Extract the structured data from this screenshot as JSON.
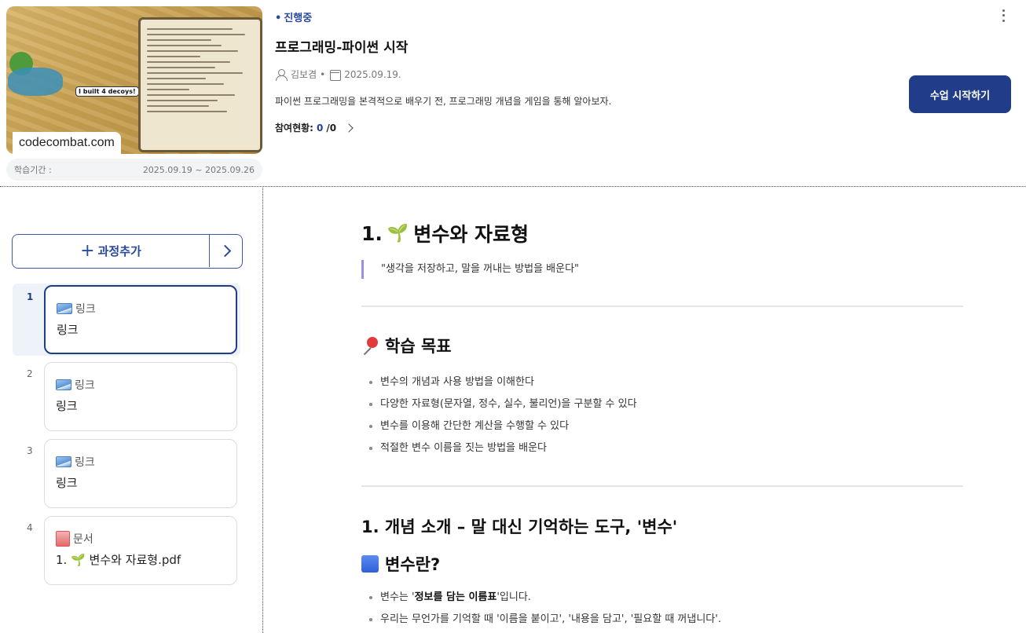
{
  "course": {
    "thumbnail_caption": "codecombat.com",
    "thumbnail_bubble": "I built 4 decoys!",
    "period_label": "학습기간 :",
    "period_value": "2025.09.19 ~ 2025.09.26",
    "status": "진행중",
    "title": "프로그래밍-파이썬 시작",
    "author": "김보겸",
    "meta_separator": "•",
    "date": "2025.09.19.",
    "description": "파이썬 프로그래밍을 본격적으로 배우기 전, 프로그래밍 개념을 게임을 통해 알아보자.",
    "participation_label": "참여현황:",
    "participation_done": "0",
    "participation_total": "/0",
    "start_button": "수업 시작하기"
  },
  "sidebar": {
    "add_button": "과정추가",
    "steps": [
      {
        "index": "1",
        "type": "링크",
        "name": "링크",
        "icon": "image-icon",
        "active": true
      },
      {
        "index": "2",
        "type": "링크",
        "name": "링크",
        "icon": "image-icon",
        "active": false
      },
      {
        "index": "3",
        "type": "링크",
        "name": "링크",
        "icon": "image-icon",
        "active": false
      },
      {
        "index": "4",
        "type": "문서",
        "name": "1. 🌱 변수와 자료형.pdf",
        "icon": "document-icon",
        "active": false
      }
    ]
  },
  "content": {
    "title_num": "1.",
    "title_text": "변수와 자료형",
    "quote": "\"생각을 저장하고, 말을 꺼내는 방법을 배운다\"",
    "goals_heading": "학습 목표",
    "goals": [
      "변수의 개념과 사용 방법을 이해한다",
      "다양한 자료형(문자열, 정수, 실수, 불리언)을 구분할 수 있다",
      "변수를 이용해 간단한 계산을 수행할 수 있다",
      "적절한 변수 이름을 짓는 방법을 배운다"
    ],
    "section1_heading": "1. 개념 소개 – 말 대신 기억하는 도구, '변수'",
    "sub_heading": "변수란?",
    "sub_b1_pre": "변수는 '",
    "sub_b1_bold": "정보를 담는 이름표",
    "sub_b1_post": "'입니다.",
    "sub_b2": "우리는 무언가를 기억할 때 '이름을 붙이고', '내용을 담고', '필요할 때 꺼냅니다'."
  },
  "colors": {
    "accent": "#213c88",
    "status": "#2a4b9b",
    "quote_bar": "#9c8ee0"
  }
}
